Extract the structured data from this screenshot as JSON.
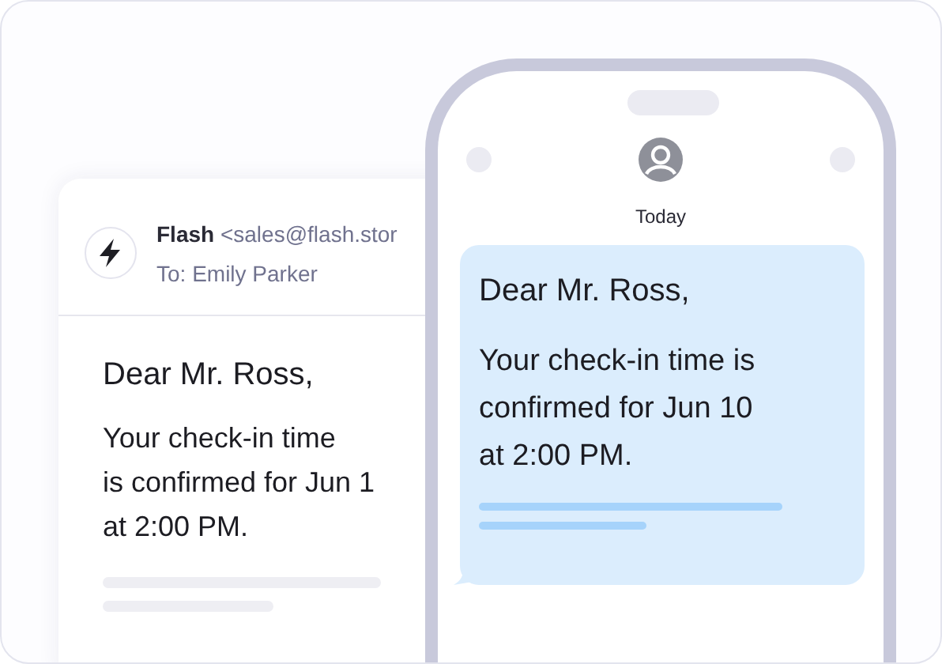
{
  "email": {
    "sender_name": "Flash",
    "sender_address": "<sales@flash.stor",
    "recipient": "To: Emily Parker",
    "greeting": "Dear Mr. Ross,",
    "body_lines": [
      "Your check-in time",
      "is confirmed for Jun 1",
      "at 2:00 PM."
    ]
  },
  "phone": {
    "date_label": "Today",
    "message": {
      "greeting": "Dear Mr. Ross,",
      "body_lines": [
        "Your check-in time is",
        "confirmed for Jun 10",
        "at 2:00 PM."
      ]
    }
  }
}
